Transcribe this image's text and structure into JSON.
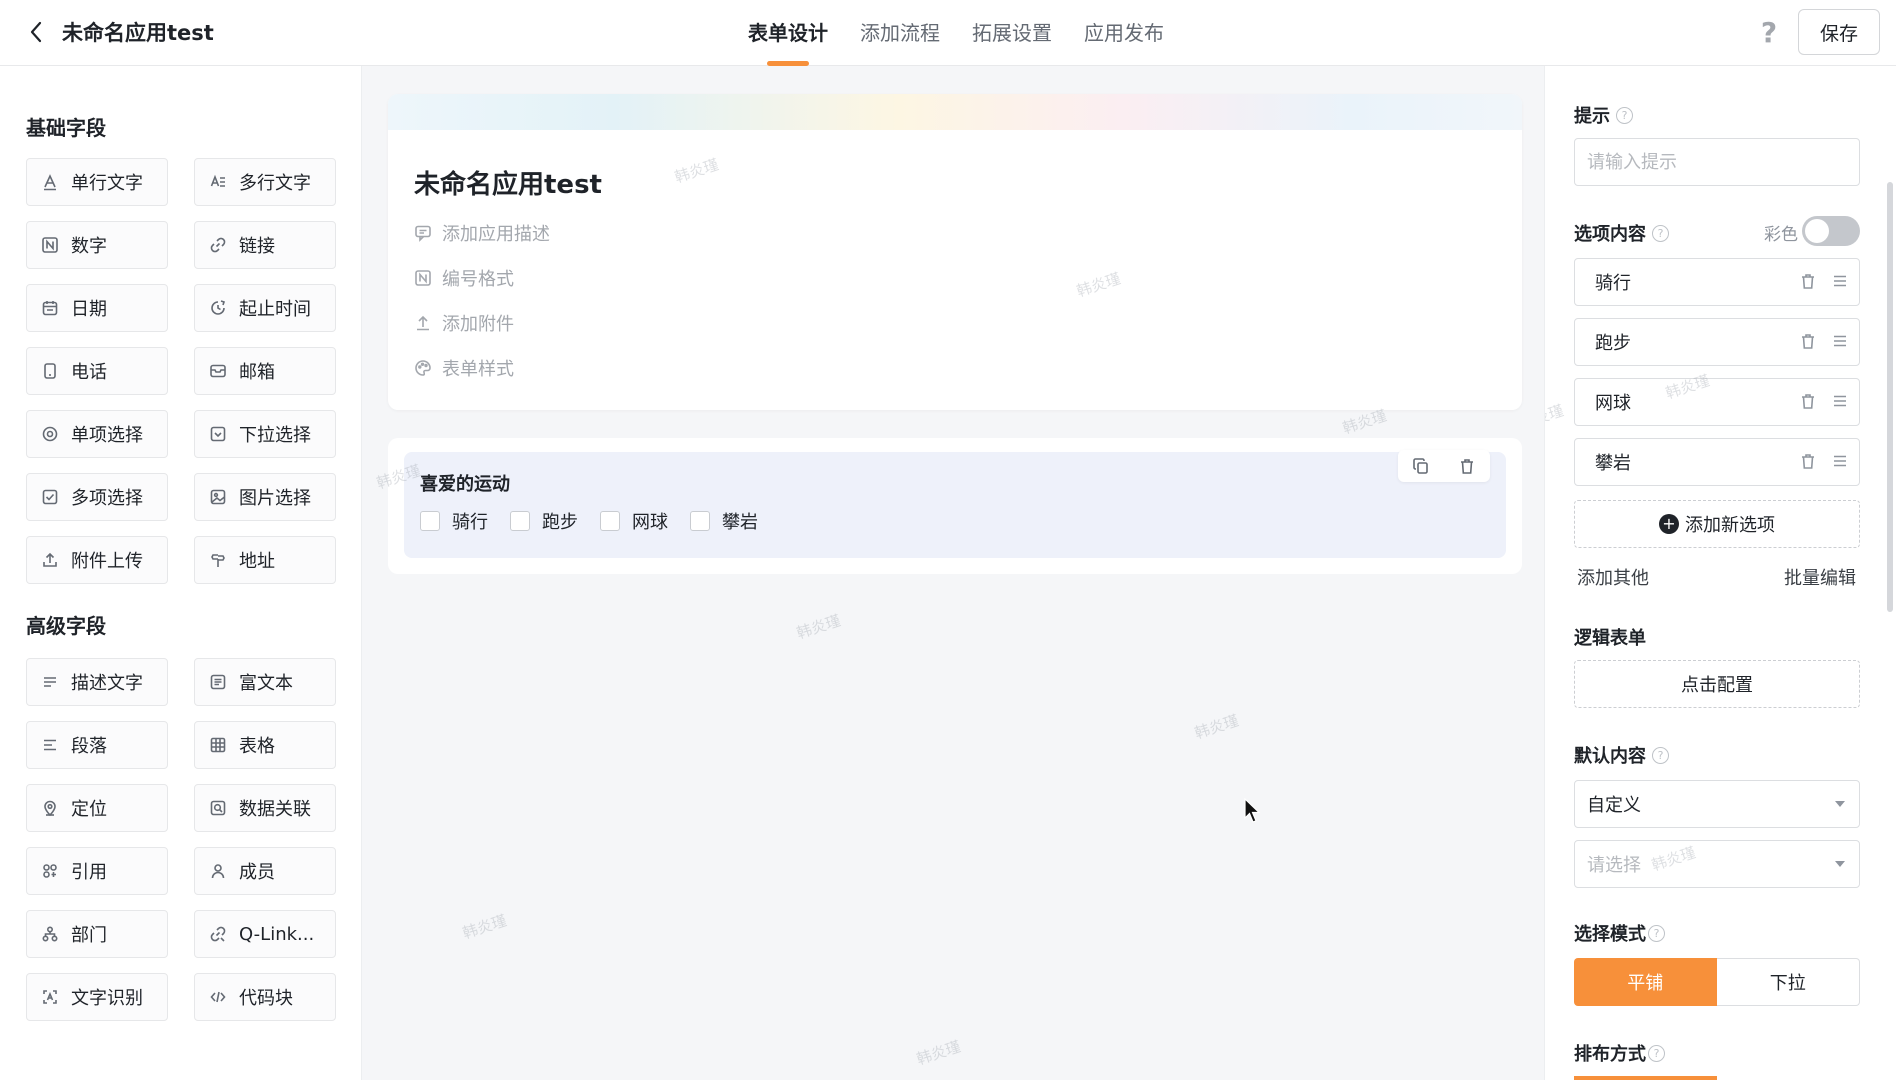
{
  "header": {
    "app_title": "未命名应用test",
    "tabs": [
      "表单设计",
      "添加流程",
      "拓展设置",
      "应用发布"
    ],
    "active_tab": 0,
    "help_glyph": "?",
    "save_label": "保存",
    "accent_color": "#f7903a"
  },
  "palette": {
    "basic_title": "基础字段",
    "basic_fields": [
      {
        "label": "单行文字",
        "icon": "text-icon"
      },
      {
        "label": "多行文字",
        "icon": "multiline-text-icon"
      },
      {
        "label": "数字",
        "icon": "number-icon"
      },
      {
        "label": "链接",
        "icon": "link-icon"
      },
      {
        "label": "日期",
        "icon": "calendar-icon"
      },
      {
        "label": "起止时间",
        "icon": "time-range-icon"
      },
      {
        "label": "电话",
        "icon": "phone-icon"
      },
      {
        "label": "邮箱",
        "icon": "mail-icon"
      },
      {
        "label": "单项选择",
        "icon": "radio-icon"
      },
      {
        "label": "下拉选择",
        "icon": "dropdown-icon"
      },
      {
        "label": "多项选择",
        "icon": "checkbox-icon"
      },
      {
        "label": "图片选择",
        "icon": "image-icon"
      },
      {
        "label": "附件上传",
        "icon": "upload-icon"
      },
      {
        "label": "地址",
        "icon": "address-icon"
      }
    ],
    "advanced_title": "高级字段",
    "advanced_fields": [
      {
        "label": "描述文字",
        "icon": "description-icon"
      },
      {
        "label": "富文本",
        "icon": "rich-text-icon"
      },
      {
        "label": "段落",
        "icon": "paragraph-icon"
      },
      {
        "label": "表格",
        "icon": "table-icon"
      },
      {
        "label": "定位",
        "icon": "location-icon"
      },
      {
        "label": "数据关联",
        "icon": "data-link-icon"
      },
      {
        "label": "引用",
        "icon": "reference-icon"
      },
      {
        "label": "成员",
        "icon": "member-icon"
      },
      {
        "label": "部门",
        "icon": "department-icon"
      },
      {
        "label": "Q-Link...",
        "icon": "qlink-icon"
      },
      {
        "label": "文字识别",
        "icon": "ocr-icon"
      },
      {
        "label": "代码块",
        "icon": "code-icon"
      }
    ]
  },
  "form": {
    "title": "未命名应用test",
    "meta": [
      {
        "label": "添加应用描述",
        "icon": "comment-icon"
      },
      {
        "label": "编号格式",
        "icon": "number-format-icon"
      },
      {
        "label": "添加附件",
        "icon": "attachment-upload-icon"
      },
      {
        "label": "表单样式",
        "icon": "palette-icon"
      }
    ],
    "question": {
      "title": "喜爱的运动",
      "options": [
        "骑行",
        "跑步",
        "网球",
        "攀岩"
      ]
    },
    "watermark": "韩炎瑾"
  },
  "props": {
    "hint_label": "提示",
    "hint_placeholder": "请输入提示",
    "options_label": "选项内容",
    "color_label": "彩色",
    "color_enabled": false,
    "options": [
      "骑行",
      "跑步",
      "网球",
      "攀岩"
    ],
    "add_option": "添加新选项",
    "add_other": "添加其他",
    "batch_edit": "批量编辑",
    "logic_label": "逻辑表单",
    "logic_button": "点击配置",
    "default_label": "默认内容",
    "default_mode": "自定义",
    "default_placeholder": "请选择",
    "select_mode_label": "选择模式",
    "select_modes": [
      "平铺",
      "下拉"
    ],
    "selected_mode": 0,
    "layout_label": "排布方式"
  }
}
